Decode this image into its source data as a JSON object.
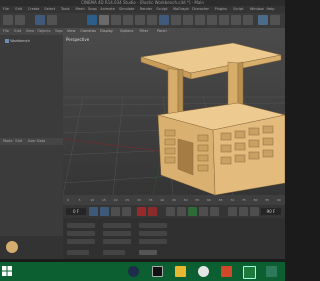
{
  "window": {
    "title": "CINEMA 4D R14.034 Studio - [Rustic Workbench.c4d *] - Main"
  },
  "menus": [
    "File",
    "Edit",
    "Create",
    "Select",
    "Tools",
    "Mesh",
    "Snap",
    "Animate",
    "Simulate",
    "Render",
    "Sculpt",
    "MoGraph",
    "Character",
    "Plugins",
    "Script",
    "Window",
    "Help"
  ],
  "left_panel": {
    "tabs": [
      "File",
      "Edit",
      "View",
      "Objects",
      "Tags"
    ],
    "object_item": "Workbench",
    "tabs2": [
      "Mode",
      "Edit",
      "User Data"
    ]
  },
  "viewport": {
    "menu": [
      "View",
      "Cameras",
      "Display",
      "Options",
      "Filter",
      "Panel"
    ],
    "label": "Perspective"
  },
  "timeline": {
    "ticks": [
      "0",
      "5",
      "10",
      "15",
      "20",
      "25",
      "30",
      "35",
      "40",
      "45",
      "50",
      "55",
      "60",
      "65",
      "70",
      "75",
      "80",
      "85",
      "90"
    ],
    "end_frame": "90 F"
  },
  "playbar": {
    "current_frame": "0 F",
    "end_frame": "90 F"
  },
  "taskbar": {
    "icons": [
      "windows-start-icon",
      "cinema4d-icon",
      "terminal-icon",
      "file-explorer-icon",
      "chrome-icon",
      "powerpoint-icon",
      "excel-icon",
      "project-icon"
    ]
  },
  "colors": {
    "wood": "#e2be80",
    "wood_dark": "#b88e50",
    "background": "#252525",
    "taskbar": "#0b5f30"
  }
}
